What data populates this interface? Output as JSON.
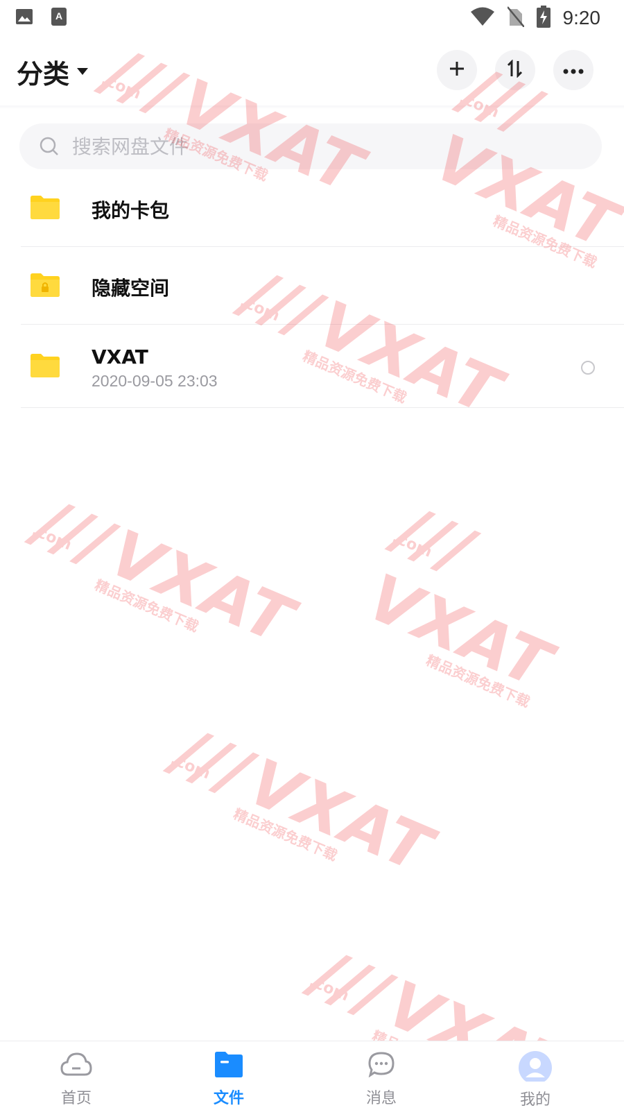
{
  "status_bar": {
    "time": "9:20",
    "left_icons": [
      "image-icon",
      "text-notification-icon"
    ],
    "right_icons": [
      "wifi-icon",
      "no-sim-icon",
      "battery-charging-icon"
    ]
  },
  "header": {
    "title": "分类",
    "actions": [
      "add-icon",
      "sort-icon",
      "more-icon"
    ]
  },
  "search": {
    "placeholder": "搜索网盘文件"
  },
  "files": [
    {
      "name": "我的卡包",
      "icon": "folder-icon"
    },
    {
      "name": "隐藏空间",
      "icon": "locked-folder-icon"
    },
    {
      "name": "VXAT",
      "date": "2020-09-05  23:03",
      "icon": "folder-icon"
    }
  ],
  "watermark": {
    "brand": "VXAT",
    "domain": ".com",
    "tagline": "精品资源免费下载"
  },
  "bottom_nav": {
    "items": [
      {
        "label": "首页",
        "icon": "cloud-icon",
        "active": false
      },
      {
        "label": "文件",
        "icon": "folder-icon",
        "active": true
      },
      {
        "label": "消息",
        "icon": "message-icon",
        "active": false
      },
      {
        "label": "我的",
        "icon": "avatar-icon",
        "active": false
      }
    ]
  },
  "colors": {
    "accent": "#1a8cff",
    "folder": "#ffd21f",
    "watermark": "#f0252b"
  }
}
